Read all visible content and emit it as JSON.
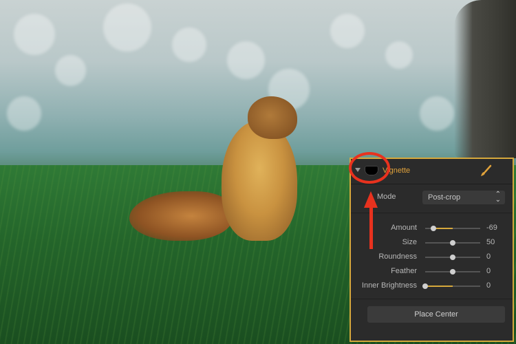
{
  "panel": {
    "title": "Vignette",
    "mode_label": "Mode",
    "mode_value": "Post-crop",
    "sliders": [
      {
        "label": "Amount",
        "value": "-69",
        "level": 0.15
      },
      {
        "label": "Size",
        "value": "50",
        "level": 0.5
      },
      {
        "label": "Roundness",
        "value": "0",
        "level": 0.5
      },
      {
        "label": "Feather",
        "value": "0",
        "level": 0.5
      },
      {
        "label": "Inner Brightness",
        "value": "0",
        "level": 0.0
      }
    ],
    "place_center": "Place Center"
  },
  "colors": {
    "accent": "#d7a93c",
    "annotation": "#e8321e",
    "panel_bg": "#2b2b2b"
  },
  "icons": {
    "collapse": "triangle-down-icon",
    "vignette": "vignette-icon",
    "brush": "brush-icon"
  }
}
